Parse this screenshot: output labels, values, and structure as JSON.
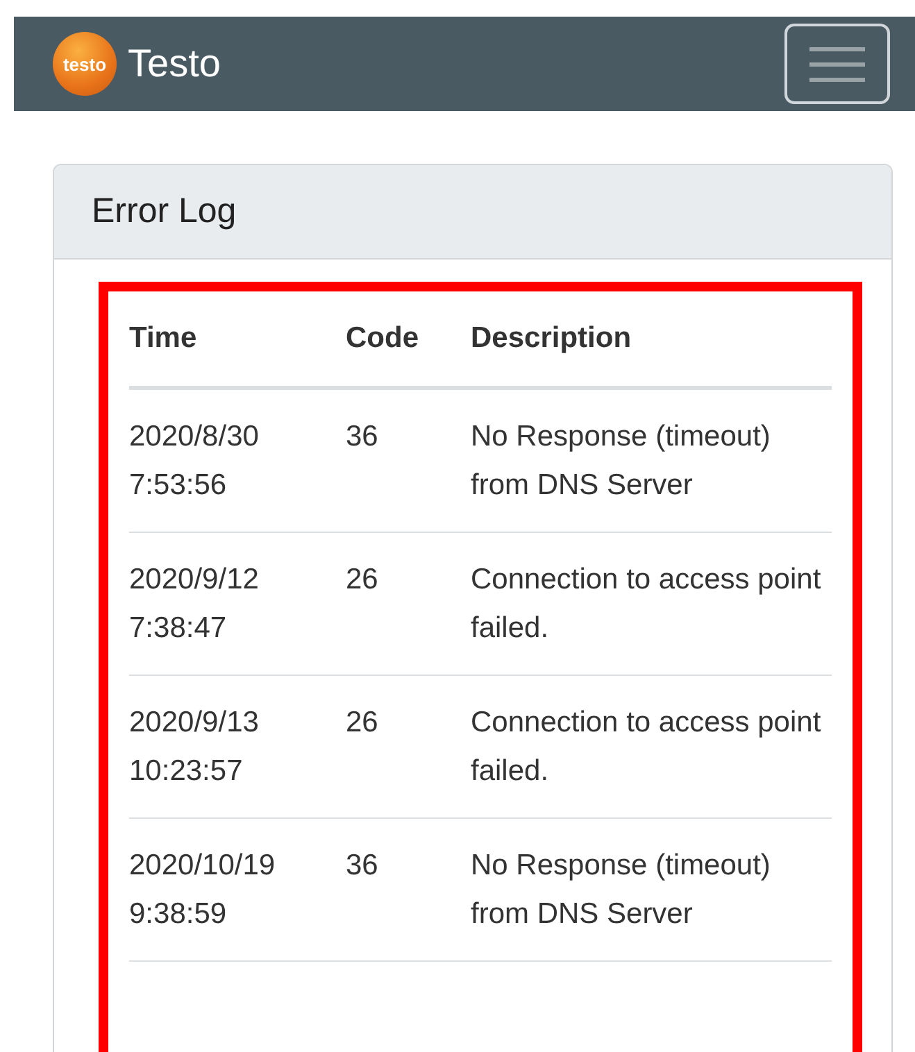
{
  "navbar": {
    "logo_text": "testo",
    "brand": "Testo"
  },
  "card": {
    "title": "Error Log",
    "highlighted": true,
    "table": {
      "columns": [
        "Time",
        "Code",
        "Description"
      ],
      "rows": [
        {
          "time": "2020/8/30 7:53:56",
          "code": "36",
          "description": "No Response (timeout) from DNS Server"
        },
        {
          "time": "2020/9/12 7:38:47",
          "code": "26",
          "description": "Connection to access point failed."
        },
        {
          "time": "2020/9/13 10:23:57",
          "code": "26",
          "description": "Connection to access point failed."
        },
        {
          "time": "2020/10/19 9:38:59",
          "code": "36",
          "description": "No Response (timeout) from DNS Server"
        }
      ]
    }
  }
}
